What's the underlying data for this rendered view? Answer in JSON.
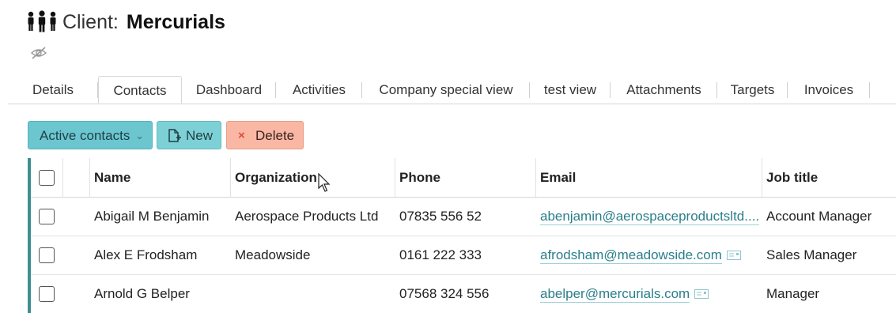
{
  "header": {
    "icon": "people-group-icon",
    "title_prefix": "Client:",
    "title_name": "Mercurials",
    "hide_icon": "eye-slash-icon"
  },
  "tabs": [
    {
      "label": "Details",
      "active": false
    },
    {
      "label": "Contacts",
      "active": true
    },
    {
      "label": "Dashboard",
      "active": false
    },
    {
      "label": "Activities",
      "active": false
    },
    {
      "label": "Company special view",
      "active": false
    },
    {
      "label": "test view",
      "active": false
    },
    {
      "label": "Attachments",
      "active": false
    },
    {
      "label": "Targets",
      "active": false
    },
    {
      "label": "Invoices",
      "active": false
    }
  ],
  "toolbar": {
    "filter_label": "Active contacts",
    "new_label": "New",
    "delete_label": "Delete"
  },
  "table": {
    "columns": [
      "Name",
      "Organization",
      "Phone",
      "Email",
      "Job title"
    ],
    "rows": [
      {
        "name": "Abigail M Benjamin",
        "organization": "Aerospace Products Ltd",
        "phone": "07835 556 52",
        "email": "abenjamin@aerospaceproductsltd....",
        "job_title": "Account Manager"
      },
      {
        "name": "Alex E Frodsham",
        "organization": "Meadowside",
        "phone": "0161 222 333",
        "email": "afrodsham@meadowside.com",
        "job_title": "Sales Manager"
      },
      {
        "name": "Arnold G Belper",
        "organization": "",
        "phone": "07568 324 556",
        "email": "abelper@mercurials.com",
        "job_title": "Manager"
      }
    ]
  },
  "colors": {
    "accent": "#6cc6d0",
    "new_button": "#7dd1d6",
    "delete_button": "#f9b7a4",
    "link": "#2a7f8a",
    "row_marker": "#3f8e94"
  }
}
